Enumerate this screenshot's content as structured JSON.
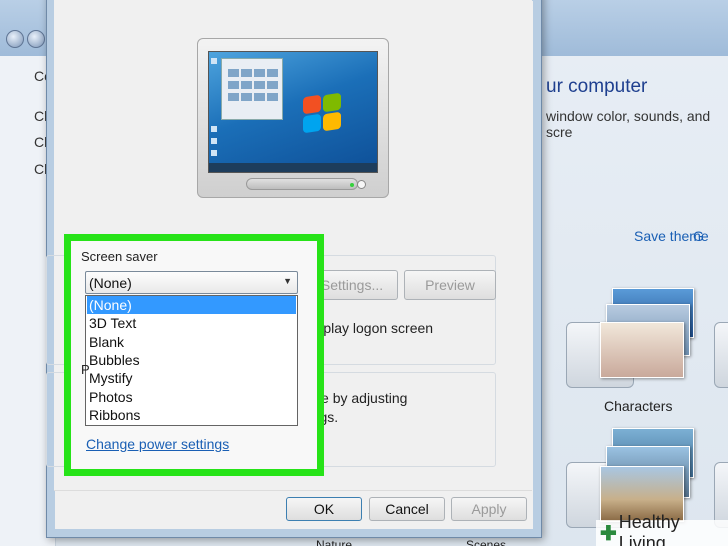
{
  "background": {
    "left_nav": [
      "Co",
      "Ch",
      "Ch",
      "Ch"
    ],
    "title": "ur computer",
    "subtitle": "window color, sounds, and scre",
    "save_theme": "Save theme",
    "more": "G",
    "characters_label": "Characters",
    "nature_label": "Nature",
    "scenes_label": "Scenes"
  },
  "dialog": {
    "screen_saver_label": "Screen saver",
    "selected_value": "(None)",
    "options": [
      "(None)",
      "3D Text",
      "Blank",
      "Bubbles",
      "Mystify",
      "Photos",
      "Ribbons"
    ],
    "selected_index": 0,
    "settings_button": "Settings...",
    "preview_button": "Preview",
    "logon_text": "m, display logon screen",
    "partial_label": "P",
    "power_text_1": "rnance by adjusting",
    "power_text_2": "settings.",
    "power_link": "Change power settings",
    "ok_button": "OK",
    "cancel_button": "Cancel",
    "apply_button": "Apply"
  },
  "watermark": {
    "text": "Healthy Living"
  },
  "colors": {
    "highlight": "#27e318",
    "selection": "#3399ff",
    "link": "#1a5fb4"
  }
}
